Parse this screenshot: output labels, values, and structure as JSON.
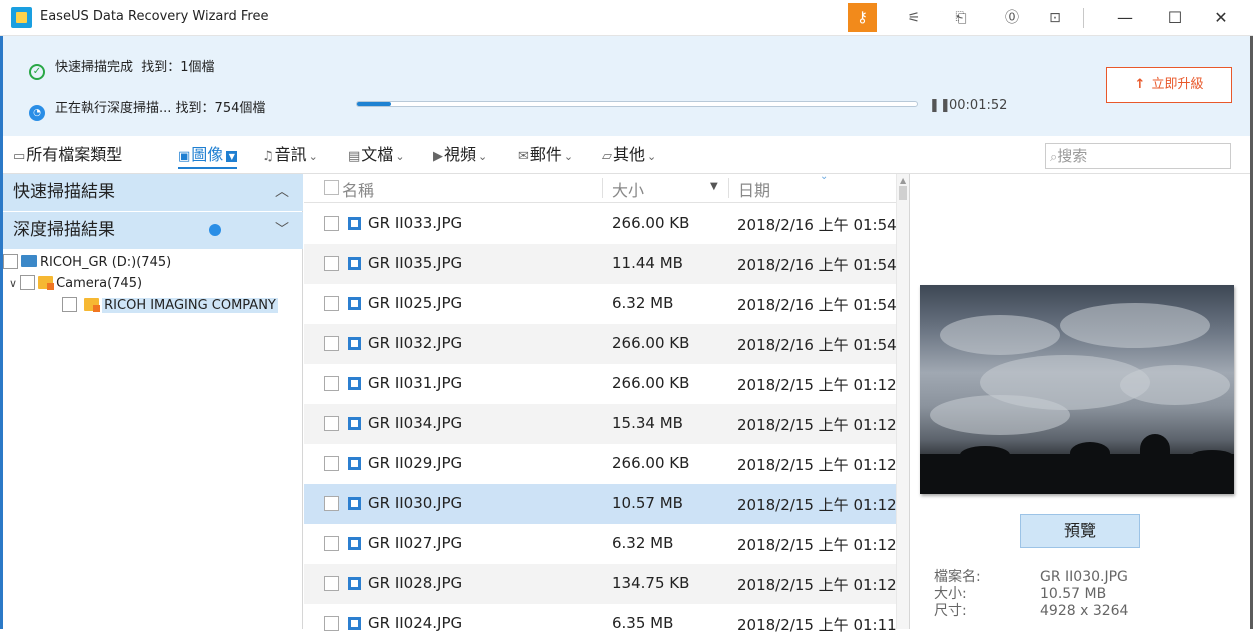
{
  "window": {
    "title": "EaseUS Data Recovery Wizard Free",
    "icons": [
      "key-icon",
      "share-icon",
      "export-icon",
      "help-icon",
      "dropdown-icon"
    ],
    "controls": {
      "minimize": "—",
      "maximize": "☐",
      "close": "✕"
    }
  },
  "status": {
    "quick_scan": {
      "label": "快速掃描完成",
      "found": "找到：1個檔"
    },
    "deep_scan": {
      "label": "正在執行深度掃描...",
      "found": "找到：754個檔"
    },
    "progress": 0.06,
    "elapsed": "00:01:52",
    "upgrade_label": "立即升級",
    "accent_color": "#e8582a"
  },
  "filters": {
    "all": "所有檔案類型",
    "items": [
      {
        "label": "圖像",
        "icon": "image-icon",
        "active": true
      },
      {
        "label": "音訊",
        "icon": "music-icon"
      },
      {
        "label": "文檔",
        "icon": "document-icon"
      },
      {
        "label": "視頻",
        "icon": "video-icon"
      },
      {
        "label": "郵件",
        "icon": "mail-icon"
      },
      {
        "label": "其他",
        "icon": "folder-icon"
      }
    ],
    "search_placeholder": "搜索"
  },
  "sidebar": {
    "quick_results": "快速掃描結果",
    "deep_results": "深度掃描結果",
    "tree": [
      {
        "label": "RICOH_GR (D:)(745)",
        "type": "drive"
      },
      {
        "label": "Camera(745)",
        "type": "folder"
      },
      {
        "label": "RICOH IMAGING COMPANY",
        "type": "folder",
        "selected": true
      }
    ]
  },
  "filelist": {
    "columns": {
      "name": "名稱",
      "size": "大小",
      "date": "日期"
    },
    "rows": [
      {
        "name": "GR II033.JPG",
        "size": "266.00 KB",
        "date": "2018/2/16 上午 01:54"
      },
      {
        "name": "GR II035.JPG",
        "size": "11.44 MB",
        "date": "2018/2/16 上午 01:54"
      },
      {
        "name": "GR II025.JPG",
        "size": "6.32 MB",
        "date": "2018/2/16 上午 01:54"
      },
      {
        "name": "GR II032.JPG",
        "size": "266.00 KB",
        "date": "2018/2/16 上午 01:54"
      },
      {
        "name": "GR II031.JPG",
        "size": "266.00 KB",
        "date": "2018/2/15 上午 01:12"
      },
      {
        "name": "GR II034.JPG",
        "size": "15.34 MB",
        "date": "2018/2/15 上午 01:12"
      },
      {
        "name": "GR II029.JPG",
        "size": "266.00 KB",
        "date": "2018/2/15 上午 01:12"
      },
      {
        "name": "GR II030.JPG",
        "size": "10.57 MB",
        "date": "2018/2/15 上午 01:12",
        "selected": true
      },
      {
        "name": "GR II027.JPG",
        "size": "6.32 MB",
        "date": "2018/2/15 上午 01:12"
      },
      {
        "name": "GR II028.JPG",
        "size": "134.75 KB",
        "date": "2018/2/15 上午 01:12"
      },
      {
        "name": "GR II024.JPG",
        "size": "6.35 MB",
        "date": "2018/2/15 上午 01:11"
      }
    ]
  },
  "preview": {
    "button_label": "預覽",
    "info": [
      {
        "label": "檔案名:",
        "value": "GR II030.JPG"
      },
      {
        "label": "大小:",
        "value": "10.57 MB"
      },
      {
        "label": "尺寸:",
        "value": "4928 x 3264"
      }
    ]
  }
}
